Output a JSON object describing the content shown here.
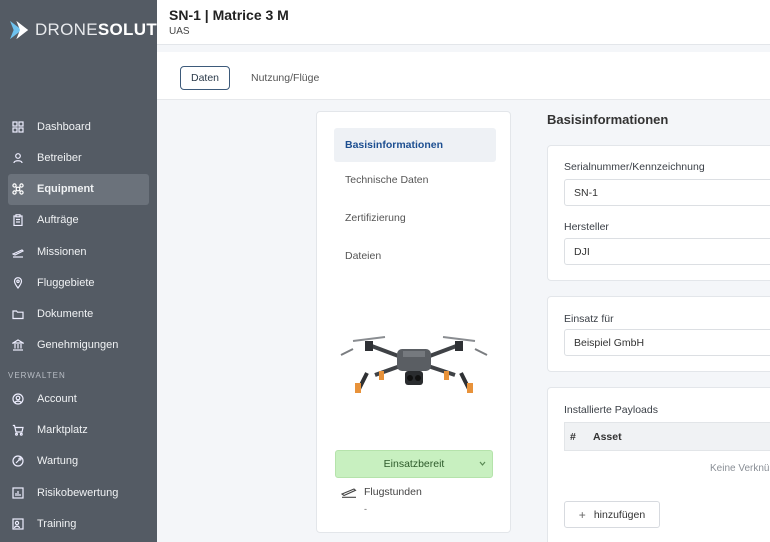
{
  "brand": {
    "light": "DRONE",
    "bold": "SOLUT"
  },
  "header": {
    "title": "SN-1 | Matrice 3 M",
    "subtitle": "UAS"
  },
  "sidebar": {
    "items": [
      {
        "label": "Dashboard",
        "icon": "dashboard-icon"
      },
      {
        "label": "Betreiber",
        "icon": "user-icon"
      },
      {
        "label": "Equipment",
        "icon": "drone-icon",
        "active": true
      },
      {
        "label": "Aufträge",
        "icon": "clipboard-icon"
      },
      {
        "label": "Missionen",
        "icon": "plane-takeoff-icon"
      },
      {
        "label": "Fluggebiete",
        "icon": "map-pin-icon"
      },
      {
        "label": "Dokumente",
        "icon": "folder-icon"
      },
      {
        "label": "Genehmigungen",
        "icon": "bank-icon"
      }
    ],
    "section_label": "VERWALTEN",
    "manage_items": [
      {
        "label": "Account",
        "icon": "account-icon"
      },
      {
        "label": "Marktplatz",
        "icon": "cart-icon"
      },
      {
        "label": "Wartung",
        "icon": "wrench-icon"
      },
      {
        "label": "Risikobewertung",
        "icon": "chart-icon"
      },
      {
        "label": "Training",
        "icon": "training-icon"
      }
    ]
  },
  "tabs": {
    "daten": "Daten",
    "nutzung": "Nutzung/Flüge"
  },
  "left_menu": {
    "items": [
      "Basisinformationen",
      "Technische Daten",
      "Zertifizierung",
      "Dateien"
    ],
    "status": "Einsatzbereit",
    "flight_hours_label": "Flugstunden",
    "flight_hours_value": "-"
  },
  "basis": {
    "title": "Basisinformationen",
    "serial_label": "Serialnummer/Kennzeichnung",
    "serial_value": "SN-1",
    "manufacturer_label": "Hersteller",
    "manufacturer_value": "DJI",
    "deployment_label": "Einsatz für",
    "deployment_value": "Beispiel GmbH",
    "payloads_label": "Installierte Payloads",
    "payloads_col_num": "#",
    "payloads_col_asset": "Asset",
    "payloads_empty": "Keine Verknü",
    "add_label": "hinzufügen"
  },
  "colors": {
    "sidebar": "#545b64",
    "status_green": "#c8f0c0",
    "accent": "#1d4f91"
  }
}
